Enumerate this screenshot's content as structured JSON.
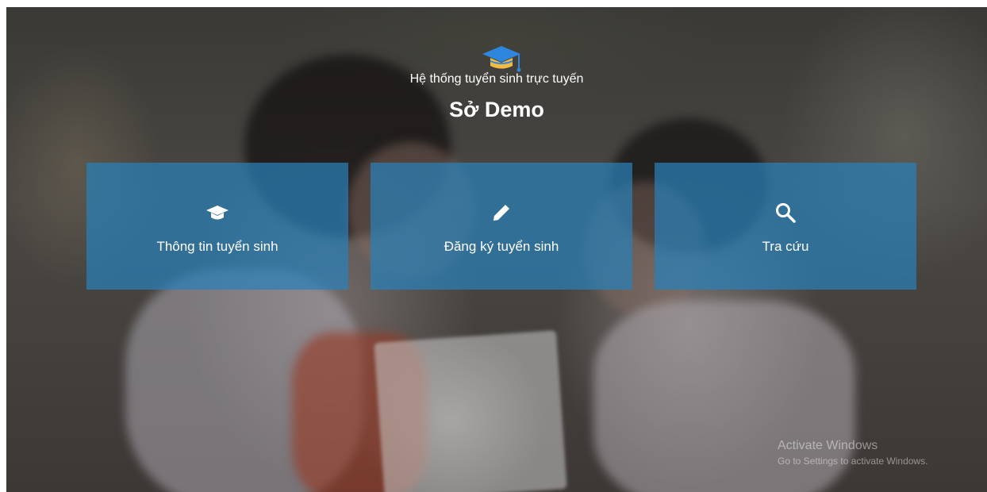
{
  "header": {
    "logo_icon": "graduation-cap-icon",
    "subtitle": "Hệ thống tuyển sinh trực tuyến",
    "title": "Sở Demo"
  },
  "tiles": [
    {
      "icon": "graduation-cap-icon",
      "label": "Thông tin tuyển sinh"
    },
    {
      "icon": "pencil-icon",
      "label": "Đăng ký tuyển sinh"
    },
    {
      "icon": "search-icon",
      "label": "Tra cứu"
    }
  ],
  "watermark": {
    "title": "Activate Windows",
    "subtitle": "Go to Settings to activate Windows."
  },
  "colors": {
    "tile_background": "#2980b9",
    "logo_cap": "#2e86de",
    "logo_band": "#f4b942",
    "text": "#ffffff"
  }
}
